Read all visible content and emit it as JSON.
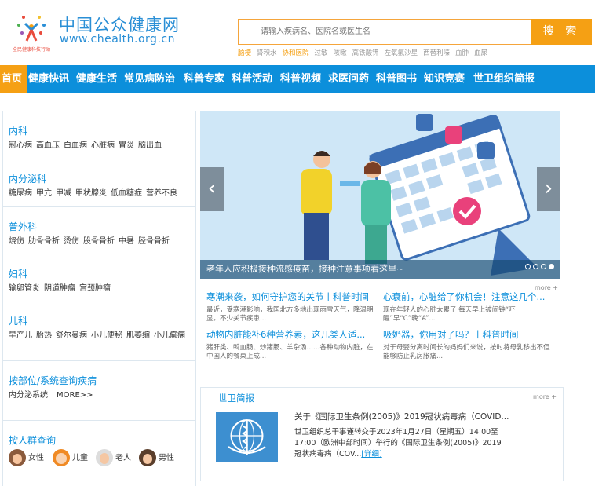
{
  "header": {
    "site_title": "中国公众健康网",
    "site_url": "www.chealth.org.cn",
    "logo_caption": "全民健康科技行动",
    "search_placeholder": "请输入疾病名、医院名或医生名",
    "search_button": "搜 索",
    "hot_words": [
      {
        "label": "脑梗",
        "hot": true
      },
      {
        "label": "肾积水",
        "hot": false
      },
      {
        "label": "协和医院",
        "hot": true
      },
      {
        "label": "过敏",
        "hot": false
      },
      {
        "label": "咳嗽",
        "hot": false
      },
      {
        "label": "高铁酸钾",
        "hot": false
      },
      {
        "label": "左氧氟沙星",
        "hot": false
      },
      {
        "label": "西替利嗪",
        "hot": false
      },
      {
        "label": "血肿",
        "hot": false
      },
      {
        "label": "血尿",
        "hot": false
      }
    ]
  },
  "nav": [
    "首页",
    "健康快讯",
    "健康生活",
    "常见病防治",
    "科普专家",
    "科普活动",
    "科普视频",
    "求医问药",
    "科普图书",
    "知识竞赛",
    "世卫组织简报"
  ],
  "sidebar": {
    "categories": [
      {
        "title": "内科",
        "links": [
          "冠心病",
          "高血压",
          "白血病",
          "心脏病",
          "胃炎",
          "脑出血"
        ]
      },
      {
        "title": "内分泌科",
        "links": [
          "糖尿病",
          "甲亢",
          "甲减",
          "甲状腺炎",
          "低血糖症",
          "营养不良"
        ]
      },
      {
        "title": "普外科",
        "links": [
          "烧伤",
          "肋骨骨折",
          "烫伤",
          "股骨骨折",
          "中暑",
          "胫骨骨折"
        ]
      },
      {
        "title": "妇科",
        "links": [
          "输卵管炎",
          "阴道肿瘤",
          "宫颈肿瘤"
        ]
      },
      {
        "title": "儿科",
        "links": [
          "早产儿",
          "胎热",
          "舒尔曼病",
          "小儿便秘",
          "肌萎缩",
          "小儿癫痫"
        ]
      }
    ],
    "by_part": {
      "title": "按部位/系统查询疾病",
      "links": [
        "内分泌系统",
        "MORE>>"
      ]
    },
    "by_people": {
      "title": "按人群查询",
      "items": [
        "女性",
        "儿童",
        "老人",
        "男性"
      ]
    }
  },
  "banner": {
    "caption": "老年人应积极接种流感疫苗，接种注意事项看这里~",
    "prev_icon": "‹",
    "next_icon": "›",
    "slide_index": 4,
    "slide_count": 4
  },
  "news_more": "more +",
  "news": [
    {
      "title": "寒潮来袭，如何守护您的关节丨科普时间",
      "desc": "最近，受寒潮影响，我国北方多地出现雨雪天气，降温明显。不少关节疾患..."
    },
    {
      "title": "心衰前，心脏给了你机会！注意这几个...",
      "desc": "现在年轻人的心脏太累了 每天早上被闹钟“吓醒”早“C”晚“A”..."
    },
    {
      "title": "动物内脏能补6种营养素，这几类人适...",
      "desc": "猪肝类、鸭血肠、炒猪肠、羊杂汤……各种动物内脏，在中国人的餐桌上成..."
    },
    {
      "title": "吸奶器，你用对了吗？丨科普时间",
      "desc": "对于母婴分离时间长的妈妈们来说，按时将母乳移出不但能够防止乳房胀痛..."
    }
  ],
  "who": {
    "label": "世卫简报",
    "more": "more +",
    "title": "关于《国际卫生条例(2005)》2019冠状病毒病（COVID...",
    "desc": "世卫组织总干事谨转交于2023年1月27日（星期五）14:00至17:00（欧洲中部时间）举行的《国际卫生条例(2005)》2019冠状病毒病（COV...",
    "detail": "[详细]"
  },
  "colors": {
    "primary": "#0c8fdb",
    "accent": "#f5a014"
  }
}
